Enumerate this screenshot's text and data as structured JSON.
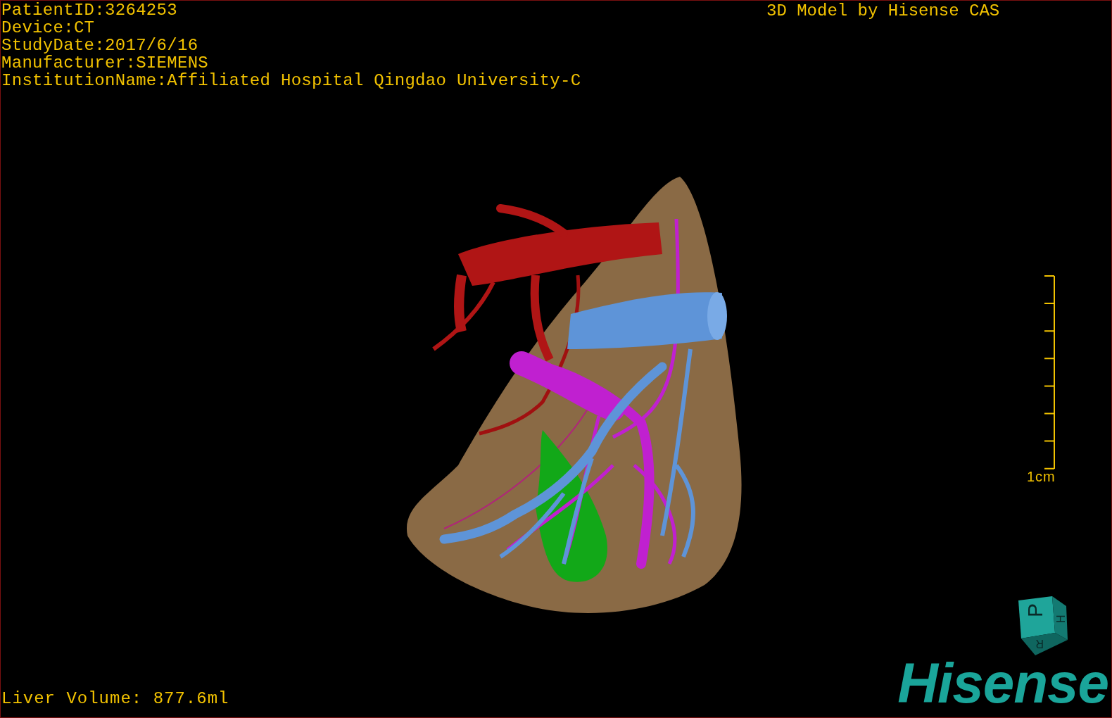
{
  "patient_info": [
    "PatientID:3264253",
    "Device:CT",
    "StudyDate:2017/6/16",
    "Manufacturer:SIEMENS",
    "InstitutionName:Affiliated Hospital Qingdao University-C"
  ],
  "model_credit": "3D Model by Hisense CAS",
  "scale_bar": {
    "label": "1cm"
  },
  "orientation_cube": {
    "front": "P",
    "side": "H",
    "bottom": "R"
  },
  "logo": "Hisense",
  "liver_volume": "Liver Volume: 877.6ml"
}
